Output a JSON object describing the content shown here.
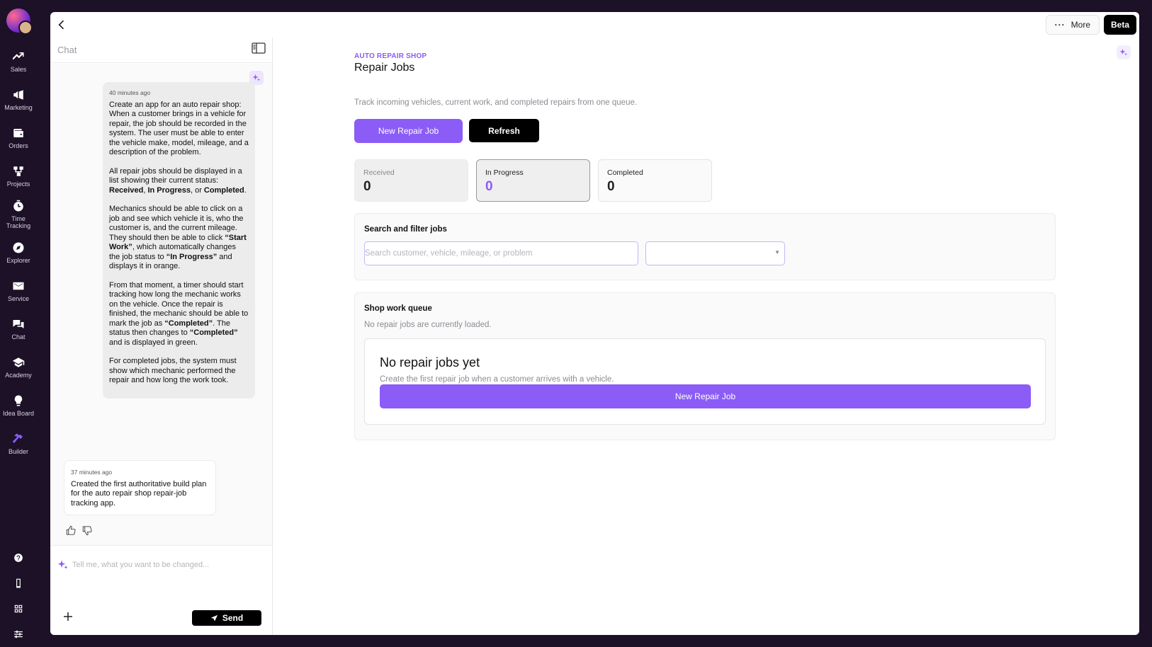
{
  "nav": {
    "items": [
      {
        "label": "Sales",
        "icon": "trend-up-icon"
      },
      {
        "label": "Marketing",
        "icon": "megaphone-icon"
      },
      {
        "label": "Orders",
        "icon": "wallet-icon"
      },
      {
        "label": "Projects",
        "icon": "nodes-icon"
      },
      {
        "label": "Time Tracking",
        "icon": "stopwatch-icon"
      },
      {
        "label": "Explorer",
        "icon": "compass-icon"
      },
      {
        "label": "Service",
        "icon": "mail-icon"
      },
      {
        "label": "Chat",
        "icon": "chat-icon"
      },
      {
        "label": "Academy",
        "icon": "graduation-cap-icon"
      },
      {
        "label": "Idea Board",
        "icon": "lightbulb-icon"
      },
      {
        "label": "Builder",
        "icon": "hammer-icon"
      }
    ],
    "active": "Builder"
  },
  "topbar": {
    "more_label": "More",
    "beta_label": "Beta"
  },
  "chat": {
    "title": "Chat",
    "user_message": {
      "time": "40 minutes ago",
      "p1": "Create an app for an auto repair shop: When a customer brings in a vehicle for repair, the job should be recorded in the system. The user must be able to enter the vehicle make, model, mileage, and a description of the problem.",
      "p2_a": "All repair jobs should be displayed in a list showing their current status: ",
      "p2_b1": "Received",
      "p2_sep1": ", ",
      "p2_b2": "In Progress",
      "p2_sep2": ", or ",
      "p2_b3": "Completed",
      "p2_end": ".",
      "p3_a": "Mechanics should be able to click on a job and see which vehicle it is, who the customer is, and the current mileage. They should then be able to click ",
      "p3_b1": "“Start Work”",
      "p3_c": ", which automatically changes the job status to ",
      "p3_b2": "“In Progress”",
      "p3_d": " and displays it in orange.",
      "p4_a": "From that moment, a timer should start tracking how long the mechanic works on the vehicle. Once the repair is finished, the mechanic should be able to mark the job as ",
      "p4_b1": "“Completed”",
      "p4_c": ". The status then changes to ",
      "p4_b2": "“Completed”",
      "p4_d": " and is displayed in green.",
      "p5": "For completed jobs, the system must show which mechanic performed the repair and how long the work took."
    },
    "bot_message": {
      "time": "37 minutes ago",
      "text": "Created the first authoritative build plan for the auto repair shop repair-job tracking app."
    },
    "input_placeholder": "Tell me, what you want to be changed...",
    "send_label": "Send"
  },
  "main": {
    "kicker": "AUTO REPAIR SHOP",
    "title": "Repair Jobs",
    "subtitle": "Track incoming vehicles, current work, and completed repairs from one queue.",
    "new_job_label": "New Repair Job",
    "refresh_label": "Refresh",
    "stats": [
      {
        "label": "Received",
        "value": "0"
      },
      {
        "label": "In Progress",
        "value": "0"
      },
      {
        "label": "Completed",
        "value": "0"
      }
    ],
    "search_card": {
      "title": "Search and filter jobs",
      "search_placeholder": "Search customer, vehicle, mileage, or problem",
      "filter_value": ""
    },
    "queue_card": {
      "title": "Shop work queue",
      "subtitle": "No repair jobs are currently loaded.",
      "empty_title": "No repair jobs yet",
      "empty_sub": "Create the first repair job when a customer arrives with a vehicle.",
      "empty_button": "New Repair Job"
    }
  },
  "colors": {
    "accent": "#8b5cf6",
    "rail_bg": "#1c1127"
  }
}
